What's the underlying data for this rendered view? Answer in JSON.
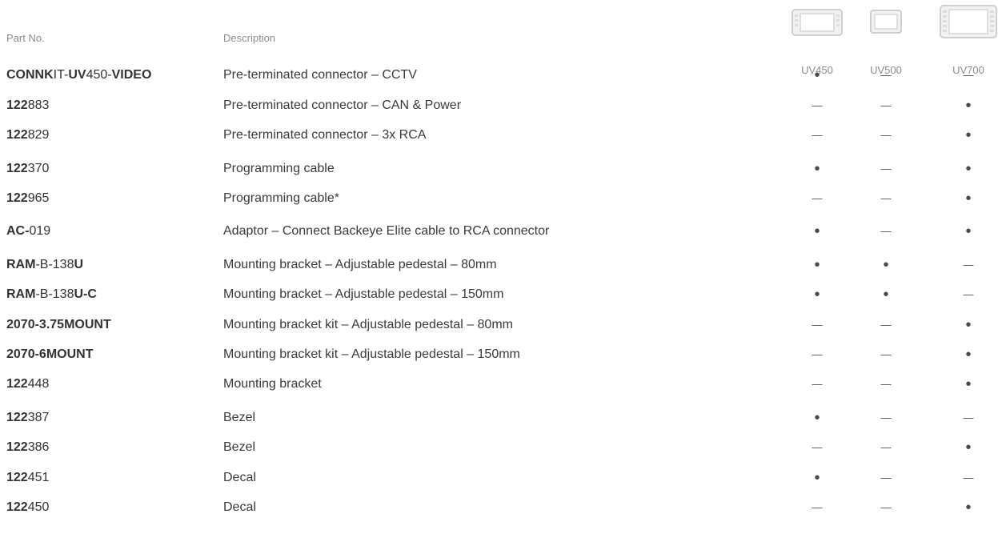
{
  "headers": {
    "part_no": "Part No.",
    "description": "Description"
  },
  "devices": [
    {
      "name": "UV450",
      "icon": "uv450-display-icon"
    },
    {
      "name": "UV500",
      "icon": "uv500-display-icon"
    },
    {
      "name": "UV700",
      "icon": "uv700-display-icon"
    }
  ],
  "compat_legend": {
    "dot": "compatible",
    "dash": "not compatible"
  },
  "rows": [
    {
      "part_segments": [
        {
          "t": "CONNK",
          "b": true
        },
        {
          "t": "IT-",
          "b": false
        },
        {
          "t": "UV",
          "b": true
        },
        {
          "t": "450-",
          "b": false
        },
        {
          "t": "VIDEO",
          "b": true
        }
      ],
      "description": "Pre-terminated connector – CCTV",
      "compat": [
        "dot",
        "dash",
        "dash"
      ]
    },
    {
      "part_segments": [
        {
          "t": "122",
          "b": true
        },
        {
          "t": "883",
          "b": false
        }
      ],
      "description": "Pre-terminated connector – CAN & Power",
      "compat": [
        "dash",
        "dash",
        "dot"
      ]
    },
    {
      "part_segments": [
        {
          "t": "122",
          "b": true
        },
        {
          "t": "829",
          "b": false
        }
      ],
      "description": "Pre-terminated connector – 3x RCA",
      "compat": [
        "dash",
        "dash",
        "dot"
      ]
    },
    {
      "part_segments": [
        {
          "t": "122",
          "b": true
        },
        {
          "t": "370",
          "b": false
        }
      ],
      "description": "Programming cable",
      "compat": [
        "dot",
        "dash",
        "dot"
      ]
    },
    {
      "part_segments": [
        {
          "t": "122",
          "b": true
        },
        {
          "t": "965",
          "b": false
        }
      ],
      "description": "Programming cable*",
      "compat": [
        "dash",
        "dash",
        "dot"
      ]
    },
    {
      "part_segments": [
        {
          "t": "AC-",
          "b": true
        },
        {
          "t": "019",
          "b": false
        }
      ],
      "description": "Adaptor – Connect Backeye Elite cable to RCA connector",
      "compat": [
        "dot",
        "dash",
        "dot"
      ]
    },
    {
      "part_segments": [
        {
          "t": "RAM",
          "b": true
        },
        {
          "t": "-B-138",
          "b": false
        },
        {
          "t": "U",
          "b": true
        }
      ],
      "description": "Mounting bracket – Adjustable pedestal – 80mm",
      "compat": [
        "dot",
        "dot",
        "dash"
      ]
    },
    {
      "part_segments": [
        {
          "t": "RAM",
          "b": true
        },
        {
          "t": "-B-138",
          "b": false
        },
        {
          "t": "U-C",
          "b": true
        }
      ],
      "description": "Mounting bracket – Adjustable pedestal – 150mm",
      "compat": [
        "dot",
        "dot",
        "dash"
      ]
    },
    {
      "part_segments": [
        {
          "t": "2070-3.75",
          "b": true
        },
        {
          "t": "MOUNT",
          "b": true
        }
      ],
      "description": "Mounting bracket kit – Adjustable pedestal – 80mm",
      "compat": [
        "dash",
        "dash",
        "dot"
      ]
    },
    {
      "part_segments": [
        {
          "t": "2070-6",
          "b": true
        },
        {
          "t": "MOUNT",
          "b": true
        }
      ],
      "description": "Mounting bracket kit – Adjustable pedestal – 150mm",
      "compat": [
        "dash",
        "dash",
        "dot"
      ]
    },
    {
      "part_segments": [
        {
          "t": "122",
          "b": true
        },
        {
          "t": "448",
          "b": false
        }
      ],
      "description": "Mounting bracket",
      "compat": [
        "dash",
        "dash",
        "dot"
      ]
    },
    {
      "part_segments": [
        {
          "t": "122",
          "b": true
        },
        {
          "t": "387",
          "b": false
        }
      ],
      "description": "Bezel",
      "compat": [
        "dot",
        "dash",
        "dash"
      ]
    },
    {
      "part_segments": [
        {
          "t": "122",
          "b": true
        },
        {
          "t": "386",
          "b": false
        }
      ],
      "description": "Bezel",
      "compat": [
        "dash",
        "dash",
        "dot"
      ]
    },
    {
      "part_segments": [
        {
          "t": "122",
          "b": true
        },
        {
          "t": "451",
          "b": false
        }
      ],
      "description": "Decal",
      "compat": [
        "dot",
        "dash",
        "dash"
      ]
    },
    {
      "part_segments": [
        {
          "t": "122",
          "b": true
        },
        {
          "t": "450",
          "b": false
        }
      ],
      "description": "Decal",
      "compat": [
        "dash",
        "dash",
        "dot"
      ]
    }
  ]
}
